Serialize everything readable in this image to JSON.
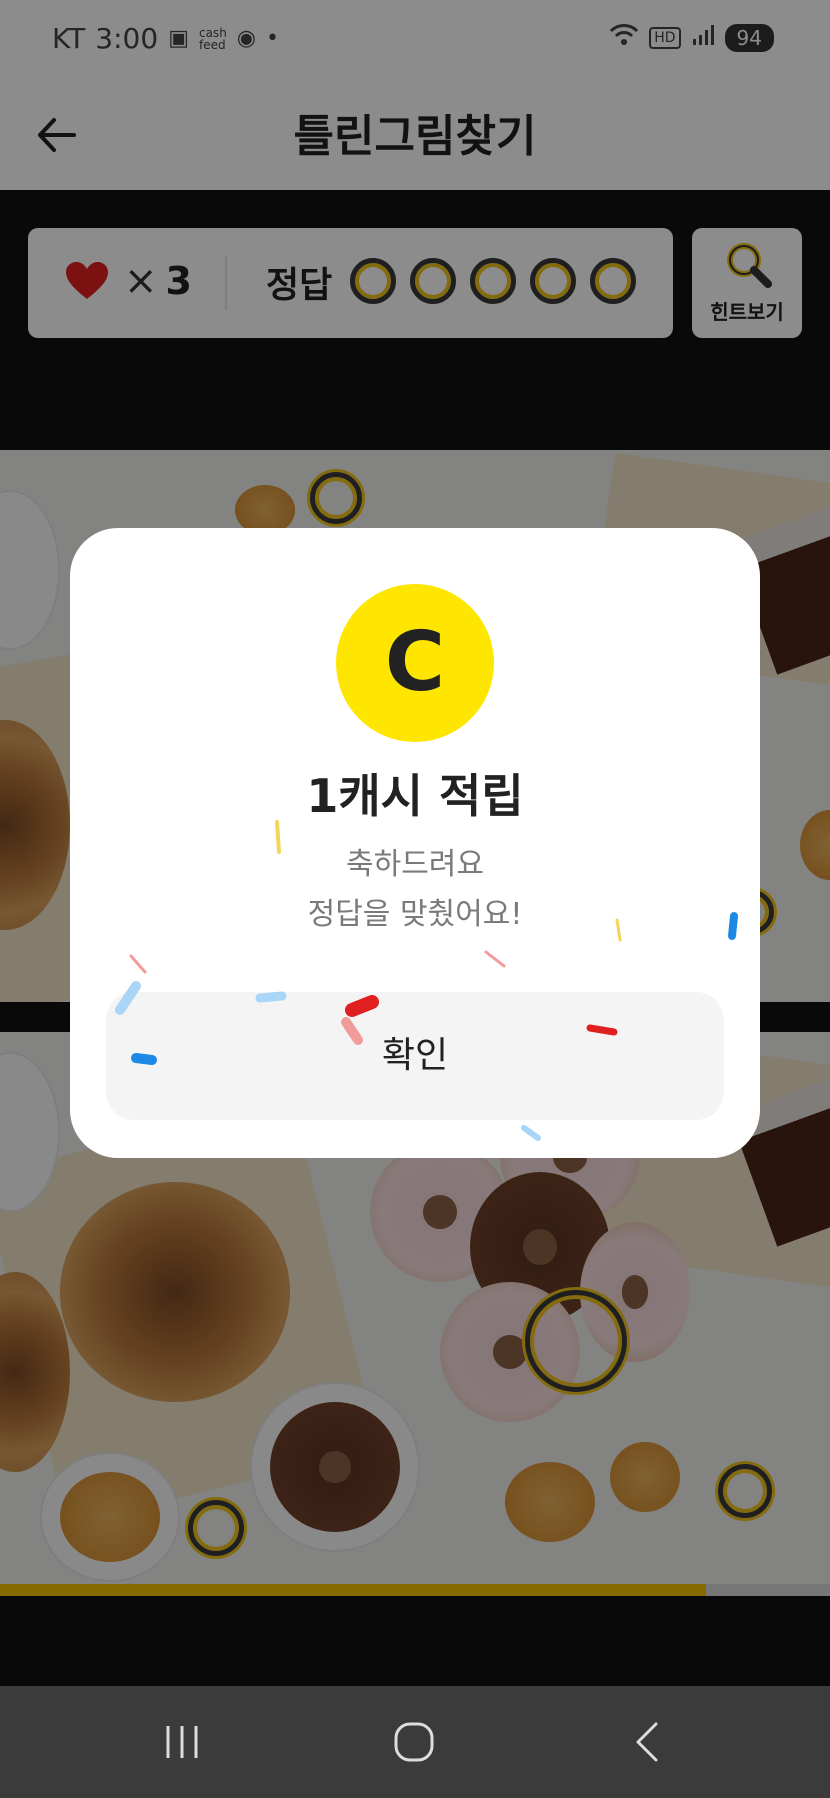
{
  "status_bar": {
    "carrier": "KT",
    "time": "3:00",
    "cashfeed_line1": "cash",
    "cashfeed_line2": "feed",
    "hd_label": "HD",
    "battery": "94"
  },
  "header": {
    "title": "틀린그림찾기",
    "back_icon": "back-arrow-icon"
  },
  "game_info": {
    "lives_symbol": "×",
    "lives_count": "3",
    "answer_label": "정답",
    "answers_total": 5,
    "hint_label": "힌트보기",
    "hint_icon": "search-icon"
  },
  "progress": {
    "fraction": 0.85,
    "fill_color": "#f2c100"
  },
  "dialog": {
    "coin_letter": "C",
    "coin_color": "#ffe600",
    "title": "1캐시 적립",
    "message_line1": "축하드려요",
    "message_line2": "정답을 맞췄어요!",
    "confirm_label": "확인"
  },
  "nav_bar": {
    "recents_icon": "recents-icon",
    "home_icon": "home-icon",
    "back_icon": "nav-back-icon"
  },
  "colors": {
    "accent": "#ffe600",
    "heart": "#e02020",
    "marker": "#f0c419"
  }
}
